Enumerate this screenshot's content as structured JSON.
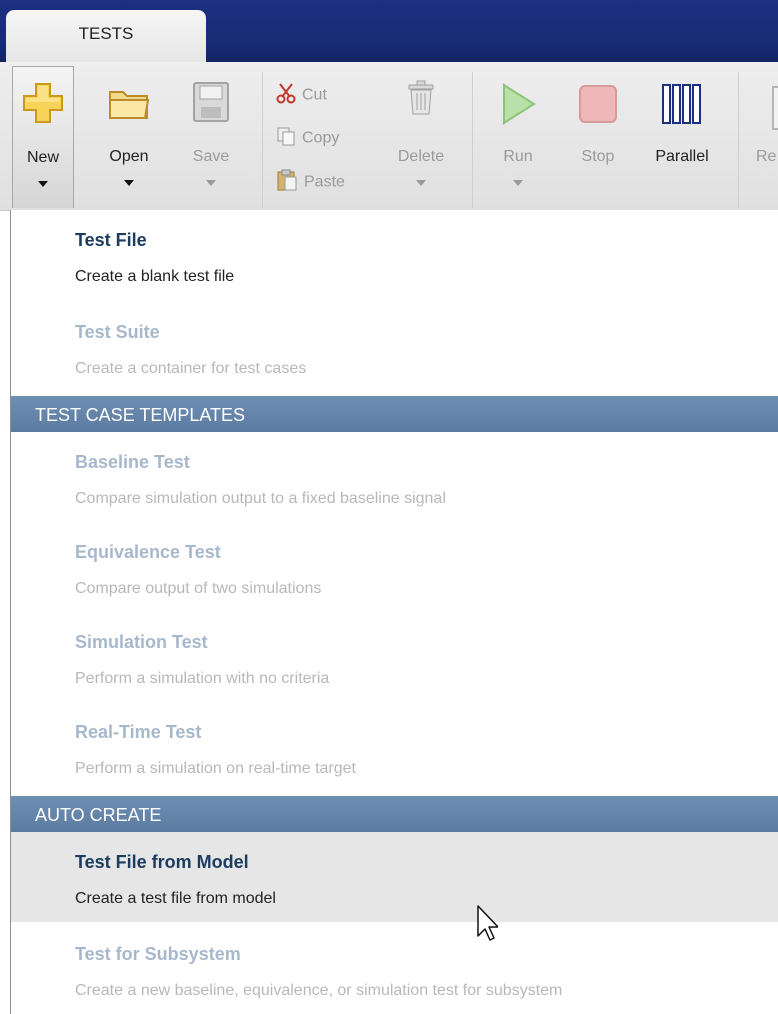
{
  "tabs": [
    {
      "label": "TESTS"
    }
  ],
  "toolbar": {
    "new": {
      "label": "New",
      "icon": "plus-icon"
    },
    "open": {
      "label": "Open",
      "icon": "folder-icon"
    },
    "save": {
      "label": "Save",
      "icon": "disk-icon"
    },
    "cut": {
      "label": "Cut",
      "icon": "scissors-icon"
    },
    "copy": {
      "label": "Copy",
      "icon": "copy-icon"
    },
    "paste": {
      "label": "Paste",
      "icon": "clipboard-icon"
    },
    "delete": {
      "label": "Delete",
      "icon": "trash-icon"
    },
    "run": {
      "label": "Run",
      "icon": "play-icon"
    },
    "stop": {
      "label": "Stop",
      "icon": "stop-icon"
    },
    "parallel": {
      "label": "Parallel",
      "icon": "parallel-bars-icon"
    },
    "report": {
      "label": "Re",
      "icon": "report-icon"
    }
  },
  "menu": {
    "items_top": [
      {
        "title": "Test File",
        "description": "Create a blank test file",
        "enabled": true
      },
      {
        "title": "Test Suite",
        "description": "Create a container for test cases",
        "enabled": false
      }
    ],
    "section_templates": "TEST CASE TEMPLATES",
    "templates": [
      {
        "title": "Baseline Test",
        "description": "Compare simulation output to a fixed baseline signal",
        "enabled": false
      },
      {
        "title": "Equivalence Test",
        "description": "Compare output of two simulations",
        "enabled": false
      },
      {
        "title": "Simulation Test",
        "description": "Perform a simulation with no criteria",
        "enabled": false
      },
      {
        "title": "Real-Time Test",
        "description": "Perform a simulation on real-time target",
        "enabled": false
      }
    ],
    "section_auto": "AUTO CREATE",
    "auto": [
      {
        "title": "Test File from Model",
        "description": "Create a test file from model",
        "enabled": true,
        "hovered": true
      },
      {
        "title": "Test for Subsystem",
        "description": "Create a new baseline, equivalence, or simulation test for subsystem",
        "enabled": false
      }
    ]
  }
}
